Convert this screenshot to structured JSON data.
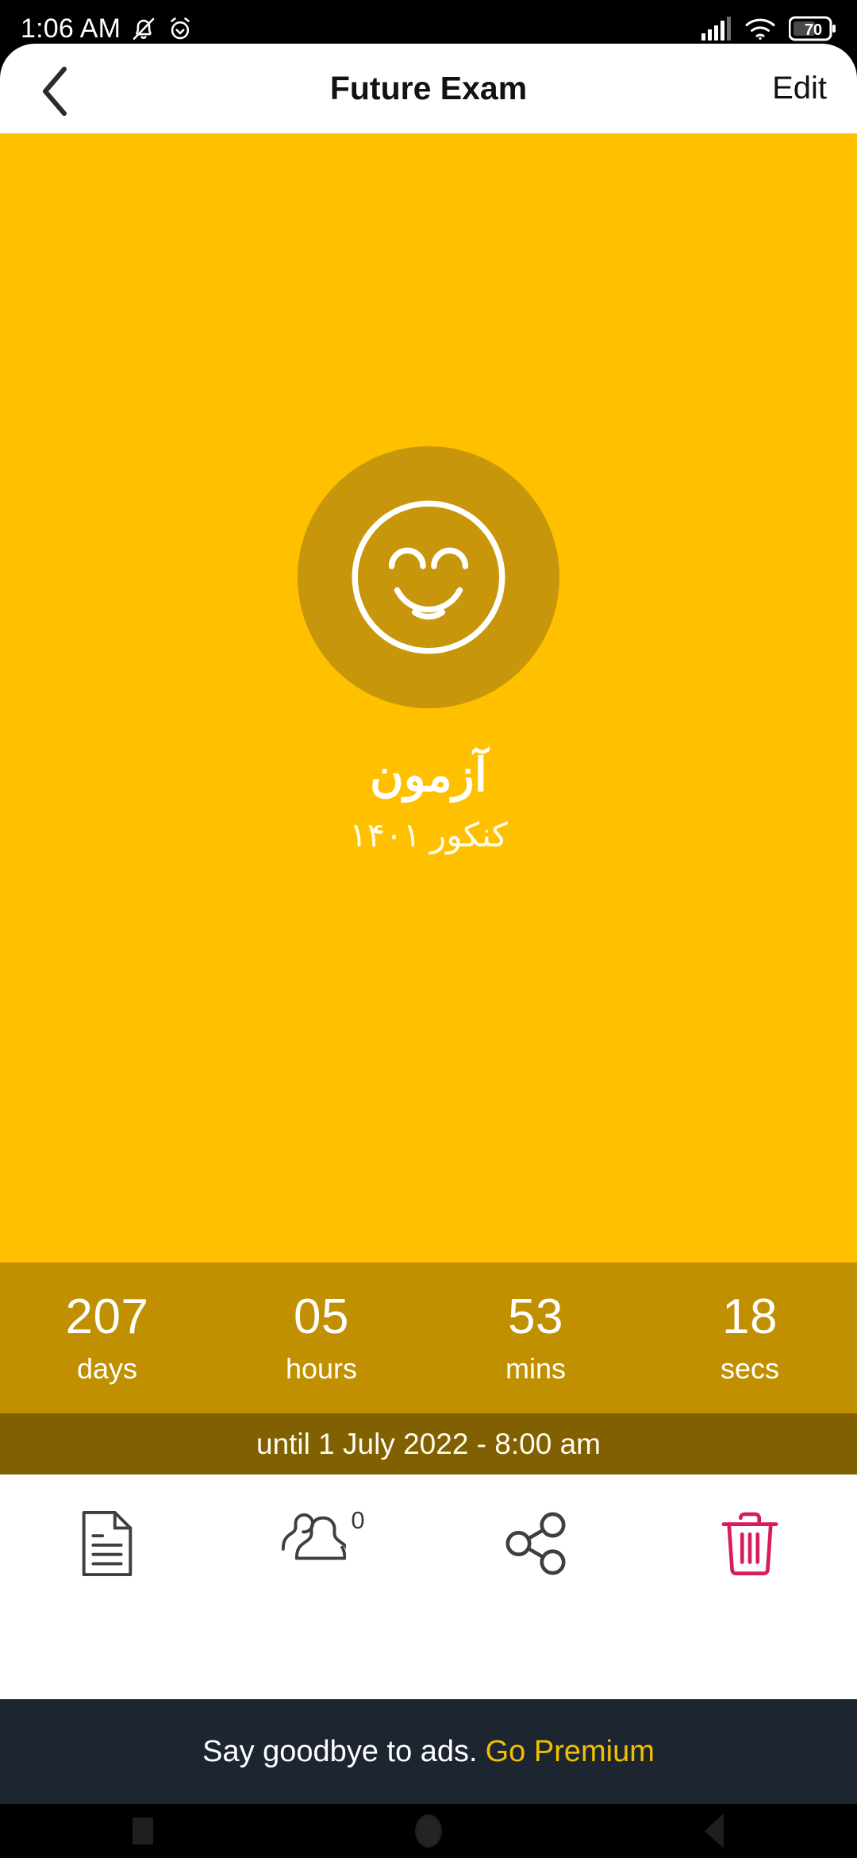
{
  "status_bar": {
    "time": "1:06 AM",
    "icons_left": [
      "notification-muted-icon",
      "alarm-icon"
    ],
    "icons_right": [
      "cellular-signal-icon",
      "wifi-icon",
      "battery-icon"
    ],
    "battery_level": "70"
  },
  "header": {
    "back_icon": "chevron-left-icon",
    "title": "Future Exam",
    "edit_label": "Edit"
  },
  "hero": {
    "avatar_icon": "smiley-face-icon",
    "background_color": "#FFC000",
    "avatar_color": "#C8960A",
    "event_title": "آزمون",
    "event_subtitle": "کنکور ۱۴۰۱"
  },
  "countdown": {
    "background_color": "#C19000",
    "units": [
      {
        "value": "207",
        "label": "days"
      },
      {
        "value": "05",
        "label": "hours"
      },
      {
        "value": "53",
        "label": "mins"
      },
      {
        "value": "18",
        "label": "secs"
      }
    ]
  },
  "until_bar": {
    "background_color": "#806000",
    "text": "until 1 July 2022 - 8:00 am"
  },
  "toolbar": {
    "note_icon": "document-note-icon",
    "people_icon": "people-icon",
    "people_count": "0",
    "share_icon": "share-icon",
    "delete_icon": "trash-icon",
    "delete_color": "#D81B5E"
  },
  "ad_banner": {
    "background_color": "#1c2530",
    "text": "Say goodbye to ads.",
    "link_label": "Go Premium",
    "link_color": "#F0C000"
  },
  "android_nav": {
    "recents_icon": "square-icon",
    "home_icon": "circle-icon",
    "back_icon": "triangle-back-icon"
  }
}
